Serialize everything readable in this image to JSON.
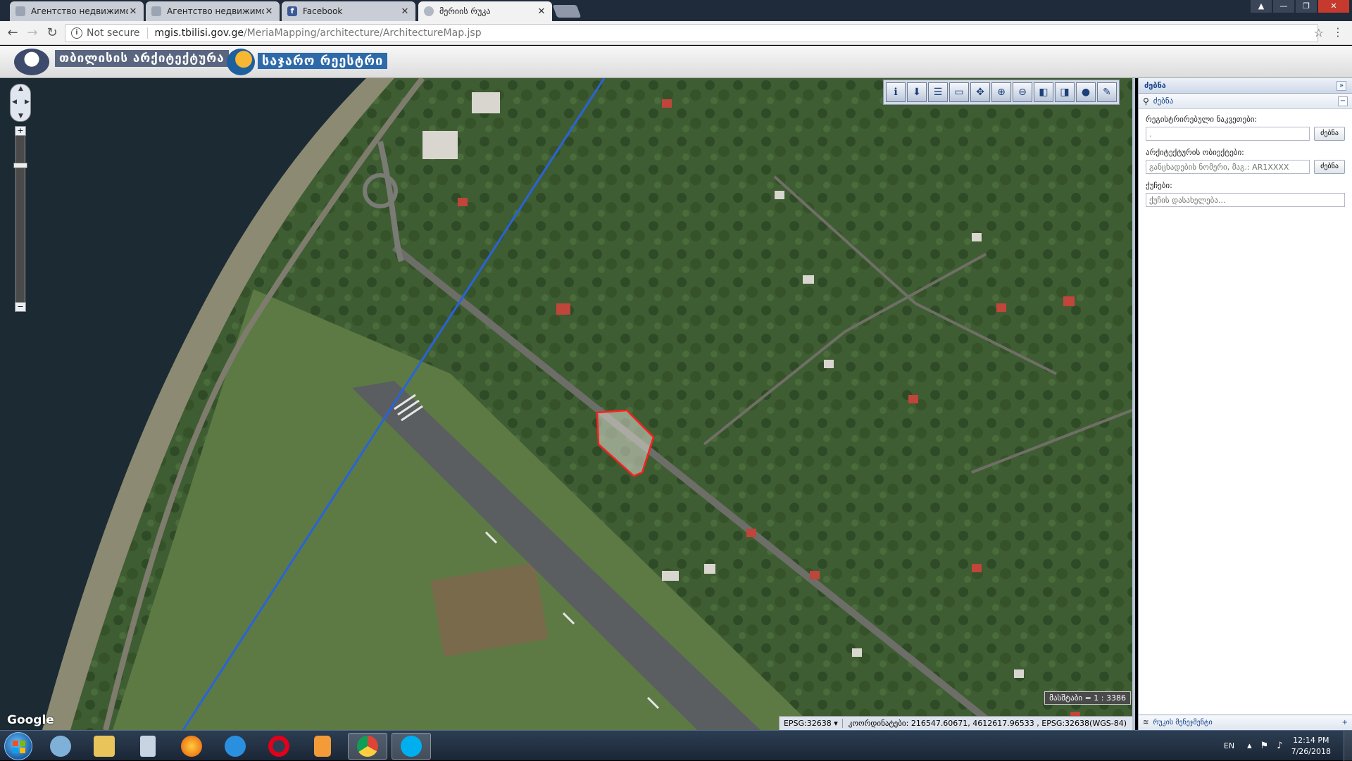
{
  "browser": {
    "tabs": [
      {
        "title": "Агентство недвижимост",
        "favicon": "globe-icon",
        "active": false
      },
      {
        "title": "Агентство недвижимост",
        "favicon": "globe-icon",
        "active": false
      },
      {
        "title": "Facebook",
        "favicon": "facebook-icon",
        "active": false
      },
      {
        "title": "მერიის რუკა",
        "favicon": "globe-icon",
        "active": true
      }
    ],
    "security_label": "Not secure",
    "url_host": "mgis.tbilisi.gov.ge",
    "url_path": "/MeriaMapping/architecture/ArchitectureMap.jsp"
  },
  "header": {
    "brand1": "თბილისის არქიტექტურა",
    "brand2": "საჯარო რეესტრი"
  },
  "map": {
    "attribution": "Google",
    "scale_label": "მასშტაბი = 1 : 3386",
    "projection": "EPSG:32638",
    "coordinates": "კოორდინატები: 216547.60671, 4612617.96533 , EPSG:32638(WGS-84)",
    "tools": [
      "info-icon",
      "identify-icon",
      "layers-icon",
      "measure-icon",
      "pan-icon",
      "zoom-in-icon",
      "zoom-out-icon",
      "zoom-prev-icon",
      "zoom-next-icon",
      "globe-icon",
      "edit-icon"
    ]
  },
  "panel": {
    "title": "ძებნა",
    "search_header": "ძებნა",
    "fields": [
      {
        "label": "რეგისტრირებული ნაკვეთები:",
        "value": ".",
        "placeholder": "",
        "button": "ძებნა"
      },
      {
        "label": "არქიტექტურის ობიექტები:",
        "value": "",
        "placeholder": "განცხადების ნომერი, მაგ.: AR1XXXX",
        "button": "ძებნა"
      },
      {
        "label": "ქუჩები:",
        "value": "",
        "placeholder": "ქუჩის დასახელება..."
      }
    ],
    "footer": "რუკის მენეჯმენტი"
  },
  "taskbar": {
    "apps": [
      "start-button",
      "skype-bird-icon",
      "explorer-icon",
      "calculator-icon",
      "firefox-icon",
      "ie-icon",
      "opera-icon",
      "media-icon",
      "chrome-icon",
      "skype-icon"
    ],
    "lang": "EN",
    "time": "12:14 PM",
    "date": "7/26/2018"
  },
  "colors": {
    "accent": "#15428b",
    "parcel": "#ff2020",
    "line": "#2a63d8"
  }
}
